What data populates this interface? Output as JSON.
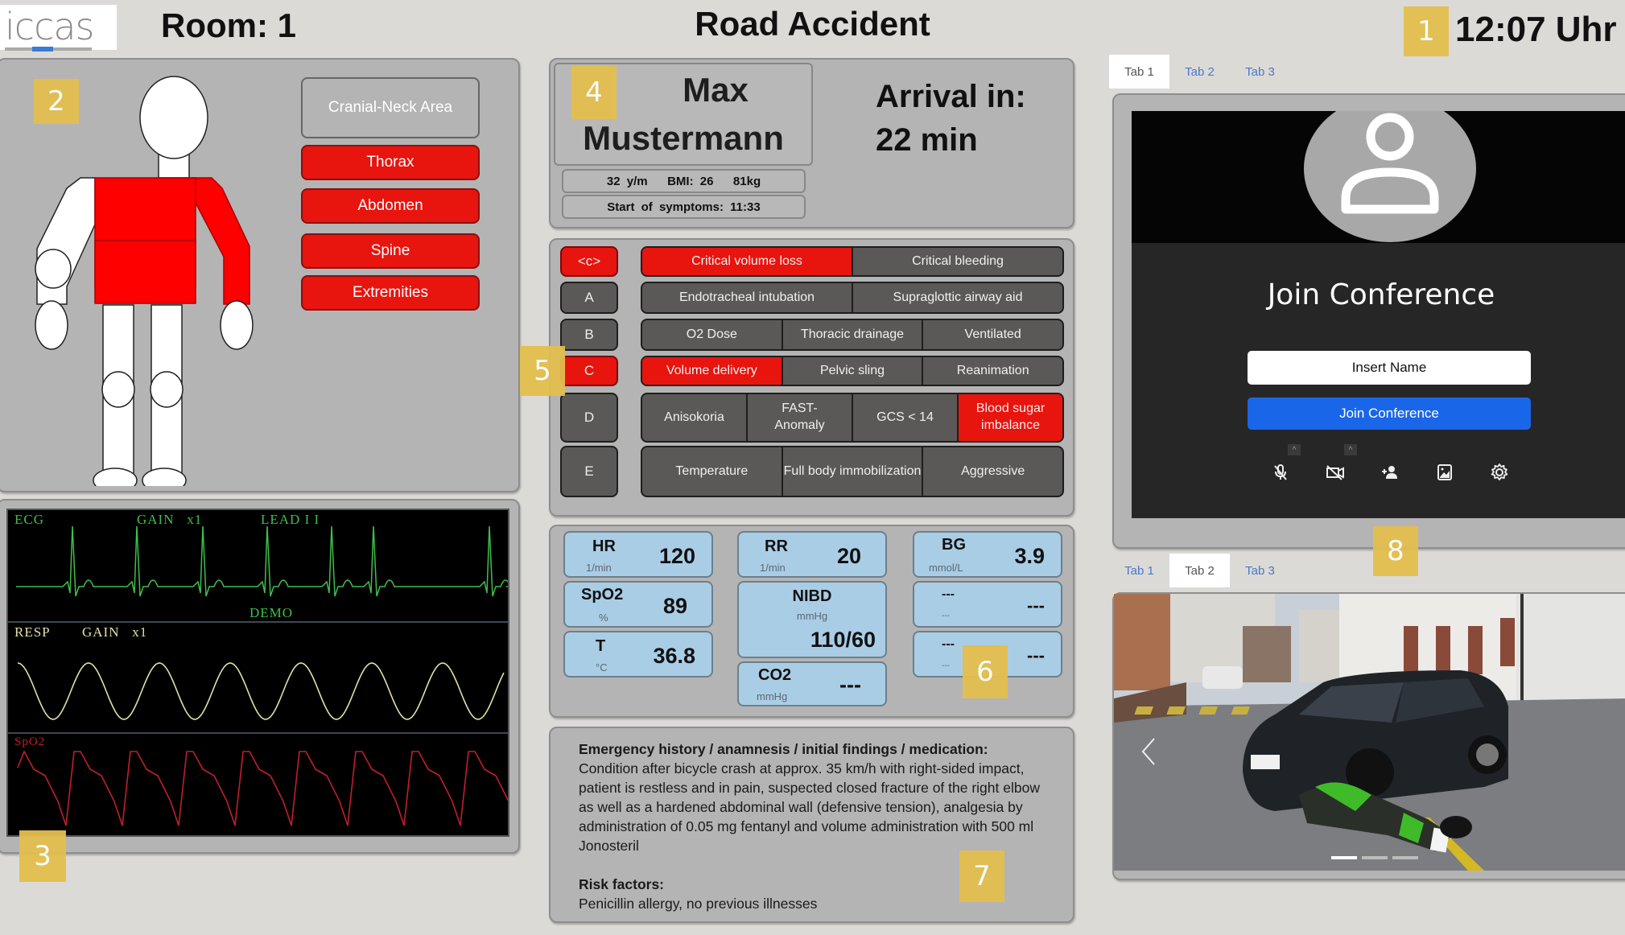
{
  "header": {
    "logo_text": "iccas",
    "room_label": "Room: 1",
    "scenario_title": "Road Accident",
    "clock": "12:07 Uhr"
  },
  "badges": [
    "1",
    "2",
    "3",
    "4",
    "5",
    "6",
    "7",
    "8"
  ],
  "body_regions": {
    "buttons": [
      {
        "label": "Cranial-Neck Area",
        "active": false
      },
      {
        "label": "Thorax",
        "active": true
      },
      {
        "label": "Abdomen",
        "active": true
      },
      {
        "label": "Spine",
        "active": true
      },
      {
        "label": "Extremities",
        "active": true
      }
    ],
    "figure_highlighted": [
      "thorax",
      "abdomen",
      "left-arm"
    ],
    "colors": {
      "active": "#e8140e",
      "neutral": "#b4b4b4"
    }
  },
  "monitor": {
    "ecg_label": "ECG",
    "ecg_gain": "GAIN   x1",
    "ecg_lead": "LEAD I I",
    "demo_label": "DEMO",
    "resp_label": "RESP",
    "resp_gain": "GAIN   x1",
    "spo2_label": "SpO2",
    "colors": {
      "ecg": "#3fbf4a",
      "resp": "#e2e0a8",
      "spo2": "#c0202a"
    }
  },
  "patient": {
    "first_name": "Max",
    "last_name": "Mustermann",
    "demographics": "32 y/m   BMI: 26   81kg",
    "symptom_start": "Start of symptoms: 11:33",
    "arrival_label": "Arrival in:",
    "arrival_value": "22 min"
  },
  "abcde": [
    {
      "key": "<c>",
      "active": true,
      "options": [
        {
          "label": "Critical volume loss",
          "active": true
        },
        {
          "label": "Critical bleeding",
          "active": false
        }
      ]
    },
    {
      "key": "A",
      "active": false,
      "options": [
        {
          "label": "Endotracheal intubation",
          "active": false
        },
        {
          "label": "Supraglottic airway aid",
          "active": false
        }
      ]
    },
    {
      "key": "B",
      "active": false,
      "options": [
        {
          "label": "O2 Dose",
          "active": false
        },
        {
          "label": "Thoracic drainage",
          "active": false
        },
        {
          "label": "Ventilated",
          "active": false
        }
      ]
    },
    {
      "key": "C",
      "active": true,
      "options": [
        {
          "label": "Volume delivery",
          "active": true
        },
        {
          "label": "Pelvic sling",
          "active": false
        },
        {
          "label": "Reanimation",
          "active": false
        }
      ]
    },
    {
      "key": "D",
      "active": false,
      "options": [
        {
          "label": "Anisokoria",
          "active": false
        },
        {
          "label": "FAST-\nAnomaly",
          "active": false
        },
        {
          "label": "GCS < 14",
          "active": false
        },
        {
          "label": "Blood sugar imbalance",
          "active": true
        }
      ]
    },
    {
      "key": "E",
      "active": false,
      "options": [
        {
          "label": "Temperature",
          "active": false
        },
        {
          "label": "Full body immobilization",
          "active": false
        },
        {
          "label": "Aggressive",
          "active": false
        }
      ]
    }
  ],
  "vitals": {
    "hr": {
      "name": "HR",
      "unit": "1/min",
      "value": "120"
    },
    "spo2": {
      "name": "SpO2",
      "unit": "%",
      "value": "89"
    },
    "temp": {
      "name": "T",
      "unit": "°C",
      "value": "36.8"
    },
    "rr": {
      "name": "RR",
      "unit": "1/min",
      "value": "20"
    },
    "nibd": {
      "name": "NIBD",
      "unit": "mmHg",
      "value": "110/60"
    },
    "co2": {
      "name": "CO2",
      "unit": "mmHg",
      "value": "---"
    },
    "bg": {
      "name": "BG",
      "unit": "mmol/L",
      "value": "3.9"
    },
    "extra1": {
      "name": "---",
      "unit": "---",
      "value": "---"
    },
    "extra2": {
      "name": "---",
      "unit": "---",
      "value": "---"
    }
  },
  "anamnesis": {
    "heading": "Emergency history / anamnesis / initial findings / medication:",
    "text": "Condition after bicycle crash at approx. 35 km/h with right-sided impact, patient is restless and in pain, suspected closed fracture of the right elbow as well as a hardened abdominal wall (defensive tension), analgesia by administration of 0.05 mg fentanyl and volume administration with 500 ml Jonosteril",
    "risk_heading": "Risk factors:",
    "risk_text": "Penicillin allergy, no previous illnesses"
  },
  "conference": {
    "tabs": [
      "Tab 1",
      "Tab 2",
      "Tab 3"
    ],
    "active_tab": 0,
    "title": "Join Conference",
    "name_placeholder": "Insert Name",
    "join_label": "Join Conference",
    "controls": [
      "mic-off-icon",
      "camera-off-icon",
      "add-person-icon",
      "background-image-icon",
      "settings-icon"
    ],
    "join_color": "#1a66e8"
  },
  "media": {
    "tabs": [
      "Tab 1",
      "Tab 2",
      "Tab 3"
    ],
    "active_tab": 1,
    "carousel_slides": 3,
    "carousel_active": 0,
    "image_description": "Accident scene: dark station wagon collided with green motorcycle on street"
  }
}
